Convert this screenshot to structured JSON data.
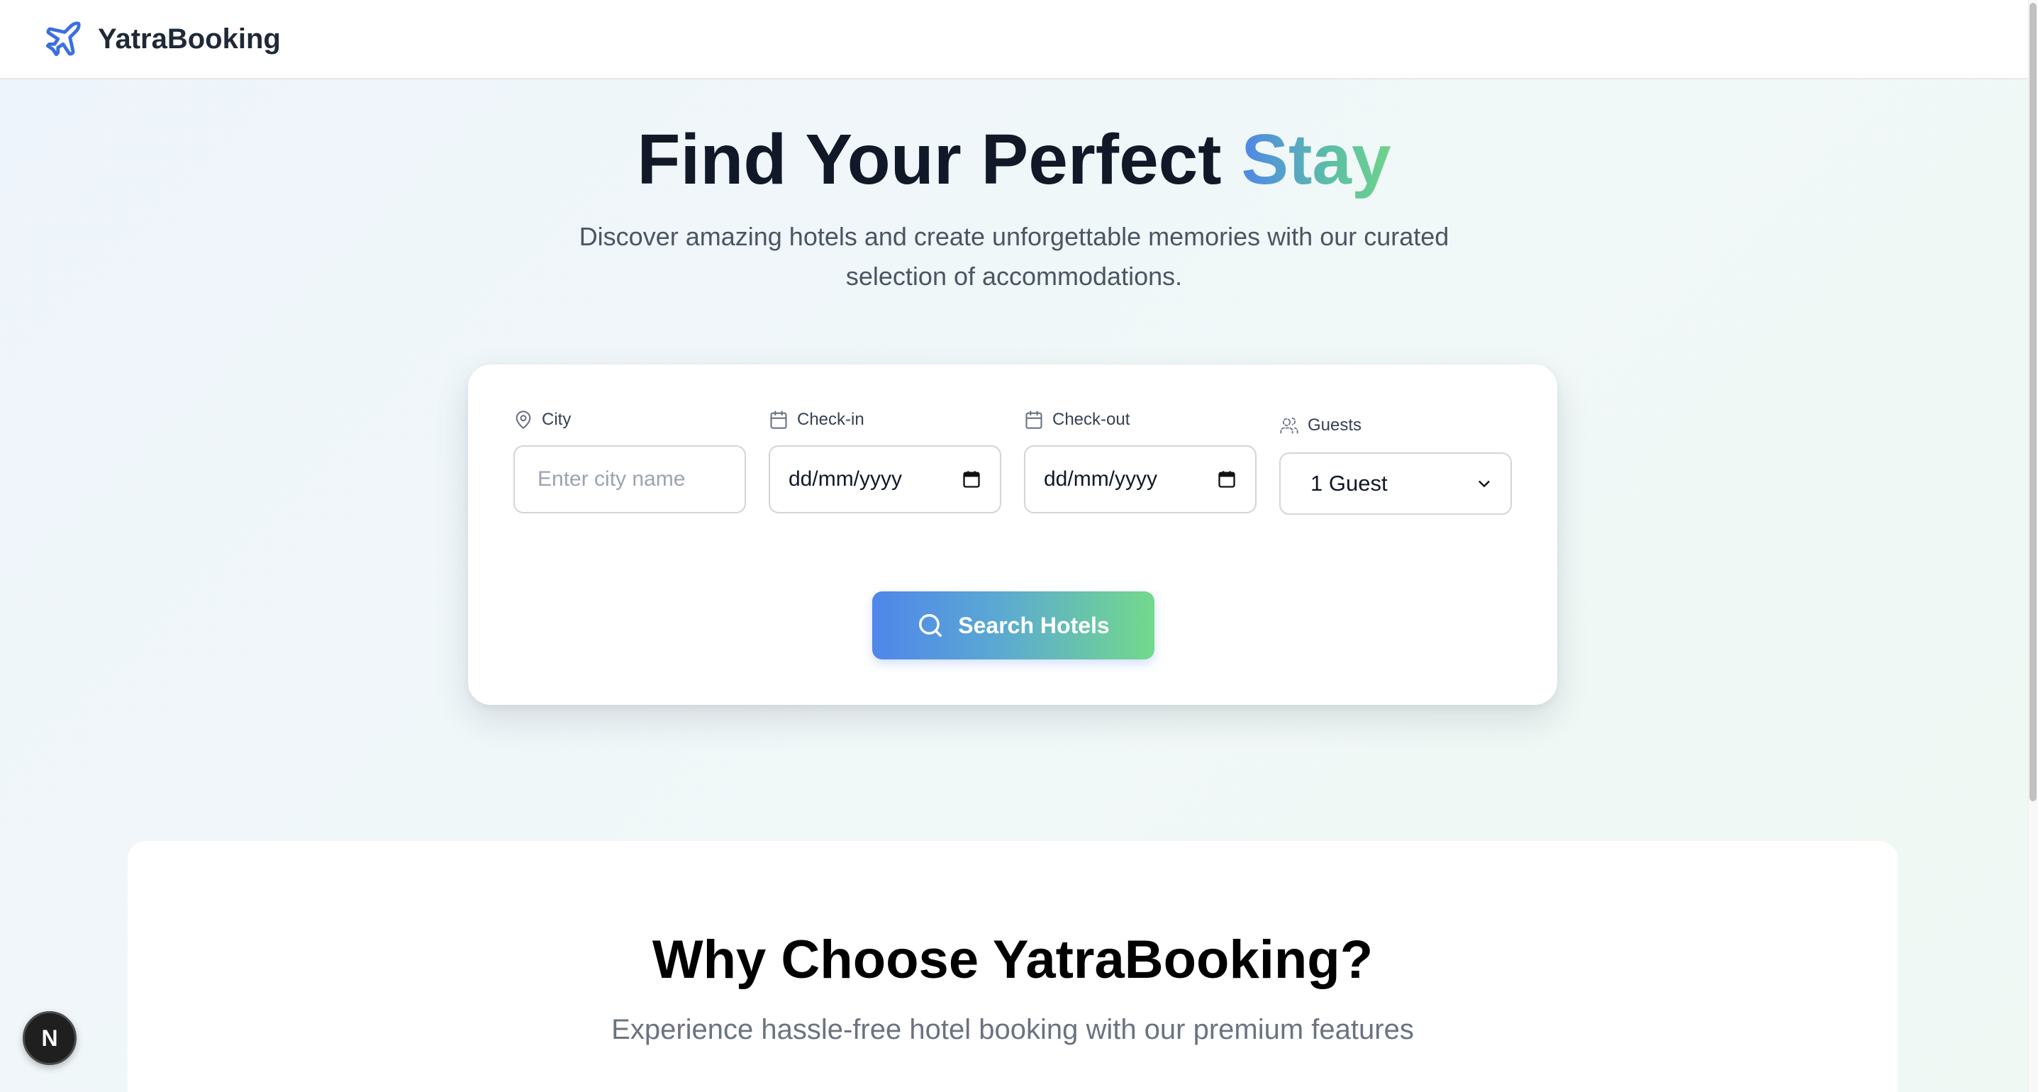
{
  "header": {
    "brand": "YatraBooking",
    "logo_icon": "airplane-icon",
    "accent_color": "#3b6fe0"
  },
  "hero": {
    "title_main": "Find Your Perfect ",
    "title_accent": "Stay",
    "subtitle": "Discover amazing hotels and create unforgettable memories with our curated selection of accommodations."
  },
  "search": {
    "city": {
      "label": "City",
      "icon": "map-pin-icon",
      "placeholder": "Enter city name",
      "value": ""
    },
    "checkin": {
      "label": "Check-in",
      "icon": "calendar-icon",
      "value": "dd/mm/yyyy"
    },
    "checkout": {
      "label": "Check-out",
      "icon": "calendar-icon",
      "value": "dd/mm/yyyy"
    },
    "guests": {
      "label": "Guests",
      "icon": "guests-icon",
      "selected": "1 Guest"
    },
    "button_label": "Search Hotels",
    "button_icon": "search-icon",
    "button_gradient": [
      "#4f86ea",
      "#73d98c"
    ]
  },
  "features": {
    "title": "Why Choose YatraBooking?",
    "subtitle": "Experience hassle-free hotel booking with our premium features"
  },
  "dev_badge": {
    "label": "N"
  }
}
